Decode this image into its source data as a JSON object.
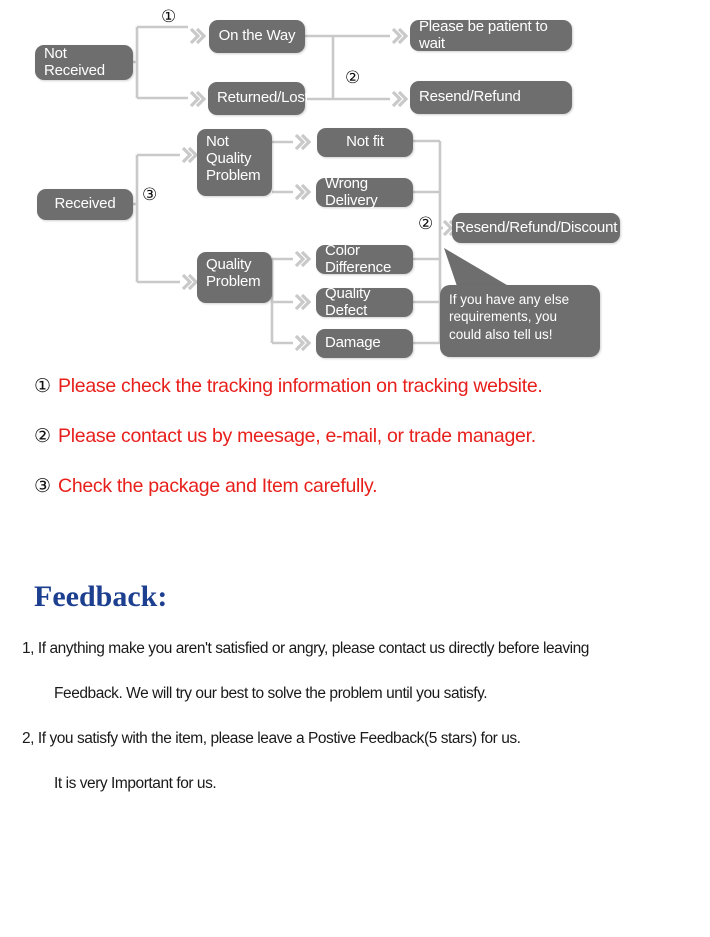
{
  "colors": {
    "node_fill": "#6e6e6e",
    "node_text": "#ffffff",
    "connector": "#c9c9c9",
    "note_red": "#e8201c",
    "feedback_blue": "#1d3f8f",
    "body_text": "#1a1a1a",
    "background": "#ffffff"
  },
  "flow": {
    "nodes": {
      "not_received": "Not Received",
      "on_the_way": "On the Way",
      "returned_lost": "Returned/Lost",
      "please_be_patient": "Please be patient to wait",
      "resend_refund": "Resend/Refund",
      "received": "Received",
      "not_quality_problem": "Not\nQuality\nProblem",
      "not_fit": "Not fit",
      "wrong_delivery": "Wrong Delivery",
      "quality_problem": "Quality\nProblem",
      "color_difference": "Color Difference",
      "quality_defect": "Quality Defect",
      "damage": "Damage",
      "resend_refund_discount": "Resend/Refund/Discount"
    },
    "markers": {
      "one_top": "①",
      "two_top": "②",
      "three_left": "③",
      "two_right": "②"
    },
    "bubble": "If you have any else requirements, you could also tell us!"
  },
  "notes": [
    {
      "num": "①",
      "text": "Please check the tracking information on tracking website."
    },
    {
      "num": "②",
      "text": "Please contact us by meesage, e-mail, or trade manager."
    },
    {
      "num": "③",
      "text": "Check the package and Item carefully."
    }
  ],
  "feedback": {
    "title": "Feedback:",
    "lines": [
      "1, If anything make you aren't satisfied or angry, please contact us directly before leaving",
      "Feedback. We will try our best to solve the problem until you satisfy.",
      "2, If you satisfy with the item, please leave a Postive Feedback(5 stars) for us.",
      "It is very Important for us."
    ]
  }
}
